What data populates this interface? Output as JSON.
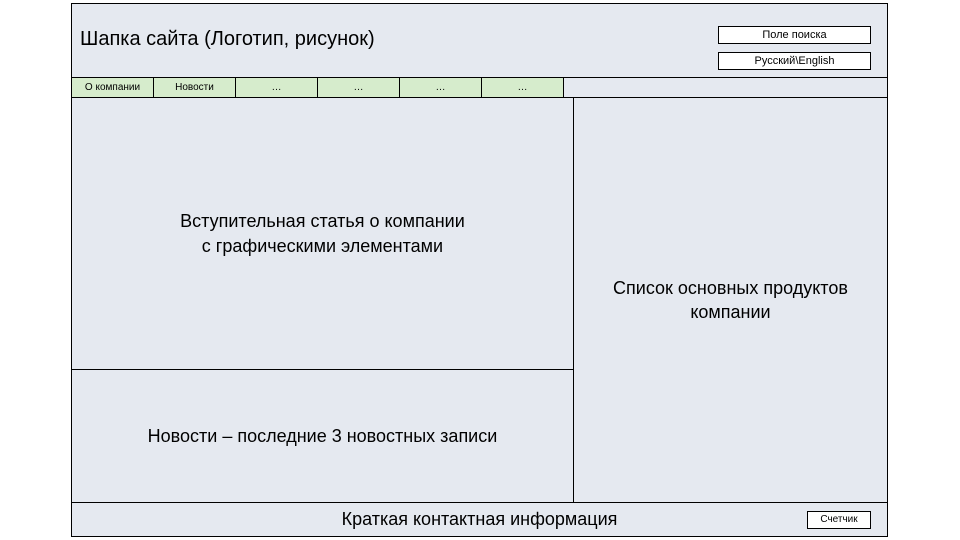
{
  "header": {
    "title": "Шапка сайта (Логотип, рисунок)",
    "search_label": "Поле поиска",
    "lang_label": "Русский\\English"
  },
  "nav": {
    "items": [
      {
        "label": "О компании"
      },
      {
        "label": "Новости"
      },
      {
        "label": "…"
      },
      {
        "label": "…"
      },
      {
        "label": "…"
      },
      {
        "label": "…"
      }
    ]
  },
  "main": {
    "intro": "Вступительная статья о компании\nс графическими элементами",
    "news": "Новости – последние 3 новостных записи",
    "products": "Список основных продуктов компании"
  },
  "footer": {
    "contact": "Краткая контактная информация",
    "counter": "Счетчик"
  }
}
